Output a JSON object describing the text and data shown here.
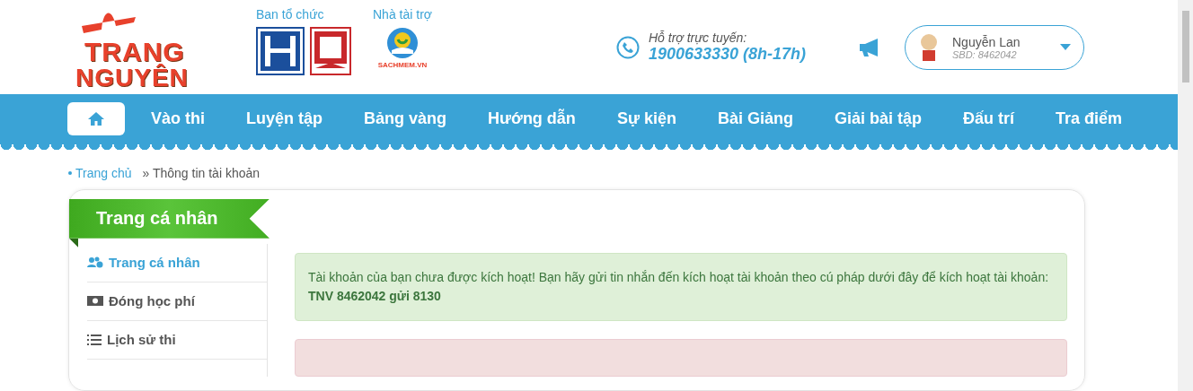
{
  "logo": {
    "line_1": "TRANG",
    "line_2": "NGUYÊN"
  },
  "organizers": {
    "label": "Ban tổ chức"
  },
  "sponsors": {
    "label": "Nhà tài trợ",
    "name": "SACHMEM.VN"
  },
  "support": {
    "label": "Hỗ trợ trực tuyến:",
    "phone": "1900633330 (8h-17h)"
  },
  "user": {
    "name": "Nguyễn Lan",
    "id": "SBD: 8462042"
  },
  "nav": {
    "items": [
      {
        "kind": "home",
        "selected": true
      },
      {
        "kind": "link",
        "label": "Vào thi",
        "selected": false
      },
      {
        "kind": "link",
        "label": "Luyện tập",
        "selected": false
      },
      {
        "kind": "link",
        "label": "Bảng vàng",
        "selected": false
      },
      {
        "kind": "link",
        "label": "Hướng dẫn",
        "selected": false
      },
      {
        "kind": "link",
        "label": "Sự kiện",
        "selected": false
      },
      {
        "kind": "link",
        "label": "Bài Giảng",
        "selected": false
      },
      {
        "kind": "link",
        "label": "Giải bài tập",
        "selected": false
      },
      {
        "kind": "link",
        "label": "Đấu trí",
        "selected": false
      },
      {
        "kind": "link",
        "label": "Tra điểm",
        "selected": false
      }
    ]
  },
  "breadcrumb": [
    "Trang chủ",
    "» Thông tin tài khoản"
  ],
  "card": {
    "title": "Trang cá nhân"
  },
  "sidebar": {
    "items": [
      {
        "label": "Trang cá nhân",
        "selected": true
      },
      {
        "label": "Đóng học phí",
        "selected": false
      },
      {
        "label": "Lịch sử thi",
        "selected": false
      }
    ]
  },
  "alert": {
    "message": "Tài khoản của bạn chưa được kích hoạt! Bạn hãy gửi tin nhắn đến kích hoạt tài khoản theo cú pháp dưới đây để kích hoạt tài khoản:",
    "code": "TNV 8462042 gửi 8130"
  }
}
